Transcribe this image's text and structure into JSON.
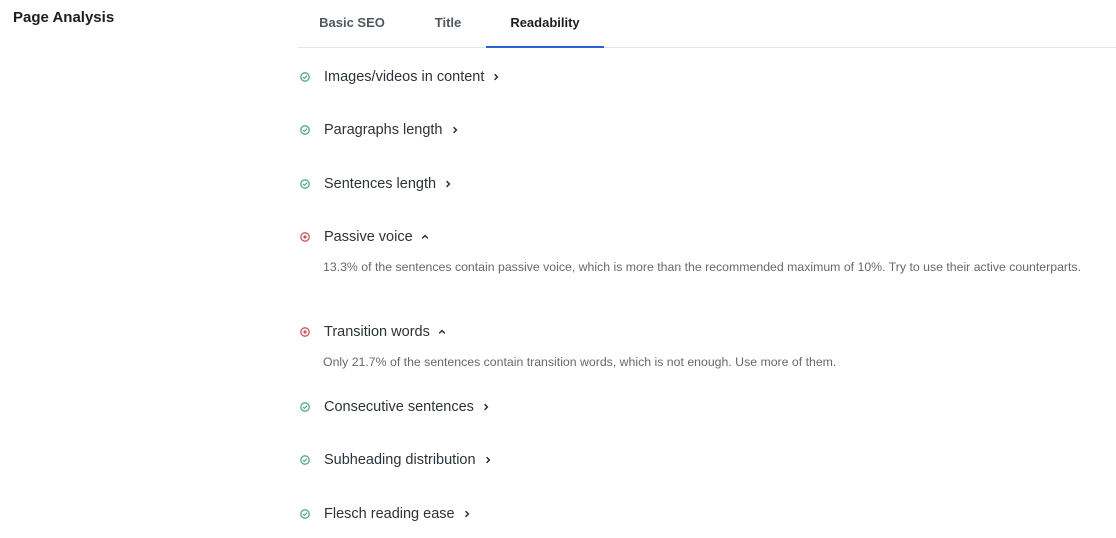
{
  "section": {
    "title": "Page Analysis"
  },
  "tabs": [
    {
      "label": "Basic SEO",
      "active": false
    },
    {
      "label": "Title",
      "active": false
    },
    {
      "label": "Readability",
      "active": true
    }
  ],
  "colors": {
    "good": "#4cae79",
    "bad": "#d94f55",
    "accent": "#2b62d6"
  },
  "checks": [
    {
      "label": "Images/videos in content",
      "status": "good",
      "expanded": false,
      "icon": "check-circle-icon"
    },
    {
      "label": "Paragraphs length",
      "status": "good",
      "expanded": false,
      "icon": "check-circle-icon"
    },
    {
      "label": "Sentences length",
      "status": "good",
      "expanded": false,
      "icon": "check-circle-icon"
    },
    {
      "label": "Passive voice",
      "status": "bad",
      "expanded": true,
      "icon": "error-circle-icon",
      "description": "13.3% of the sentences contain passive voice, which is more than the recommended maximum of 10%. Try to use their active counterparts."
    },
    {
      "label": "Transition words",
      "status": "bad",
      "expanded": true,
      "icon": "error-circle-icon",
      "description": "Only 21.7% of the sentences contain transition words, which is not enough. Use more of them."
    },
    {
      "label": "Consecutive sentences",
      "status": "good",
      "expanded": false,
      "icon": "check-circle-icon"
    },
    {
      "label": "Subheading distribution",
      "status": "good",
      "expanded": false,
      "icon": "check-circle-icon"
    },
    {
      "label": "Flesch reading ease",
      "status": "good",
      "expanded": false,
      "icon": "check-circle-icon"
    }
  ]
}
